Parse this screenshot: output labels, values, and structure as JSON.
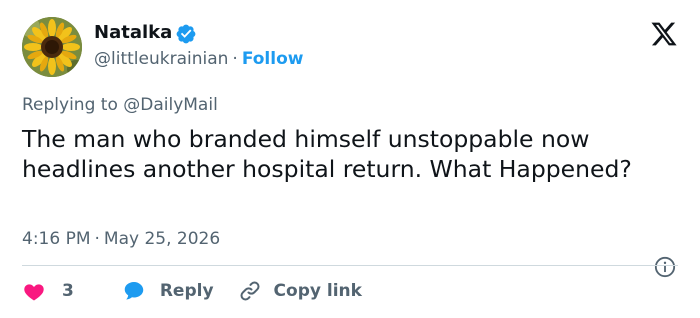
{
  "author": {
    "name": "Natalka",
    "handle": "@littleukrainian",
    "separator": "·",
    "follow_label": "Follow",
    "avatar_icon": "sunflower-avatar",
    "verified_icon": "verified-badge-icon",
    "verified_color": "#1d9bf0"
  },
  "platform_icon": "x-logo-icon",
  "reply_context": {
    "prefix": "Replying to",
    "mention": "@DailyMail"
  },
  "tweet": {
    "text": "The man who branded himself unstoppable now headlines another hospital return. What Happened?"
  },
  "meta": {
    "time": "4:16 PM",
    "separator": "·",
    "date": "May 25, 2026",
    "info_icon": "info-icon"
  },
  "actions": {
    "like_count": "3",
    "like_icon": "heart-icon",
    "like_color": "#f91880",
    "reply_label": "Reply",
    "reply_icon": "speech-bubble-icon",
    "reply_color": "#1d9bf0",
    "copy_label": "Copy link",
    "copy_icon": "link-icon"
  }
}
